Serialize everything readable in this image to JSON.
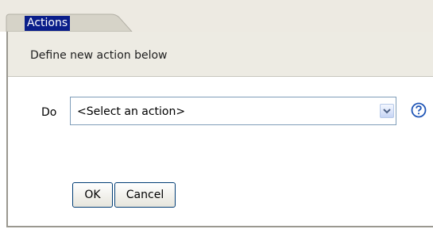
{
  "tab": {
    "label": "Actions"
  },
  "panel": {
    "header_text": "Define new action below"
  },
  "form": {
    "do_label": "Do",
    "action_select": {
      "selected": "<Select an action>"
    }
  },
  "buttons": {
    "ok_label": "OK",
    "cancel_label": "Cancel"
  },
  "colors": {
    "tab_selected_bg": "#0a1e8a",
    "header_bg": "#edebe3",
    "button_border": "#003c74",
    "help_icon": "#1f55b6"
  }
}
